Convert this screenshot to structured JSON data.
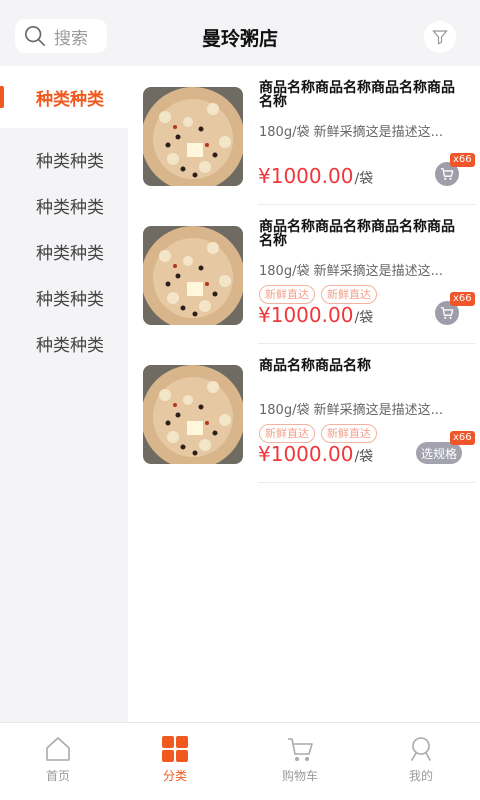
{
  "header": {
    "search_placeholder": "搜索",
    "title": "曼玲粥店"
  },
  "sidebar": {
    "items": [
      {
        "label": "种类种类",
        "active": true
      },
      {
        "label": "种类种类",
        "active": false
      },
      {
        "label": "种类种类",
        "active": false
      },
      {
        "label": "种类种类",
        "active": false
      },
      {
        "label": "种类种类",
        "active": false
      },
      {
        "label": "种类种类",
        "active": false
      }
    ]
  },
  "products": [
    {
      "name": "商品名称商品名称商品名称商品名称",
      "desc": "180g/袋 新鲜采摘这是描述这...",
      "tags": [],
      "price": "¥1000.00",
      "unit": "/袋",
      "action": "cart",
      "count": "x66"
    },
    {
      "name": "商品名称商品名称商品名称商品名称",
      "desc": "180g/袋 新鲜采摘这是描述这...",
      "tags": [
        "新鲜直达",
        "新鲜直达"
      ],
      "price": "¥1000.00",
      "unit": "/袋",
      "action": "cart",
      "count": "x66"
    },
    {
      "name": "商品名称商品名称",
      "desc": "180g/袋 新鲜采摘这是描述这...",
      "tags": [
        "新鲜直达",
        "新鲜直达"
      ],
      "price": "¥1000.00",
      "unit": "/袋",
      "action": "spec",
      "action_label": "选规格",
      "count": "x66"
    }
  ],
  "tabbar": {
    "tabs": [
      {
        "label": "首页",
        "icon": "home-icon"
      },
      {
        "label": "分类",
        "icon": "category-icon",
        "active": true
      },
      {
        "label": "购物车",
        "icon": "cart-icon"
      },
      {
        "label": "我的",
        "icon": "profile-icon"
      }
    ]
  },
  "colors": {
    "accent": "#f05a1e",
    "price": "#f0373b",
    "badge": "#f0562a",
    "tag": "#f3a08a"
  }
}
